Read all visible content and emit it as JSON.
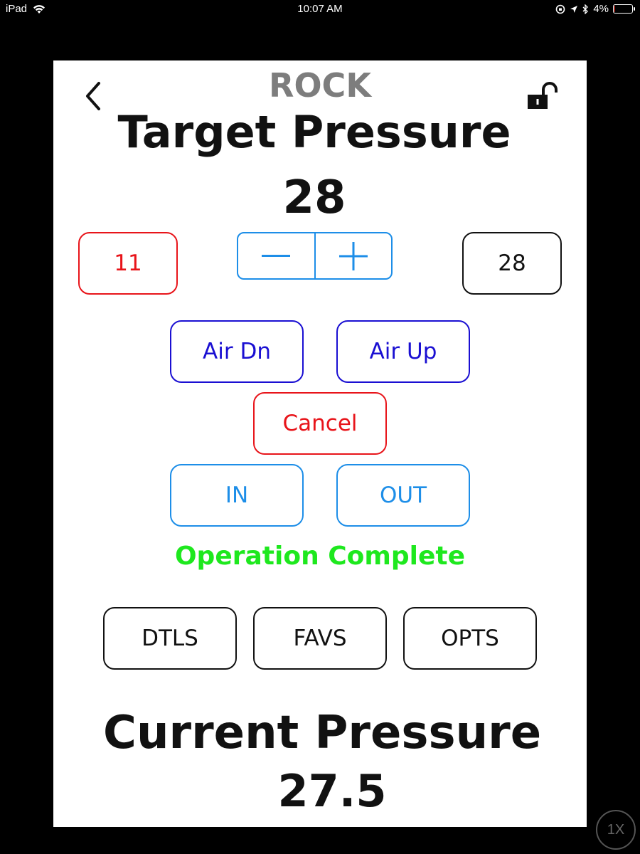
{
  "status_bar": {
    "device": "iPad",
    "time": "10:07 AM",
    "battery": "4%",
    "battery_level": 0.04
  },
  "header": {
    "title": "ROCK",
    "back_icon": "chevron-left-icon",
    "lock_icon": "unlocked-padlock-icon"
  },
  "target": {
    "title": "Target Pressure",
    "value": "28",
    "min_value": "11",
    "max_value": "28",
    "stepper": {
      "decrement": "minus-icon",
      "increment": "plus-icon"
    }
  },
  "controls": {
    "air_down": "Air Dn",
    "air_up": "Air Up",
    "cancel": "Cancel",
    "in": "IN",
    "out": "OUT"
  },
  "status_message": "Operation Complete",
  "nav": {
    "details": "DTLS",
    "favorites": "FAVS",
    "options": "OPTS"
  },
  "current": {
    "title": "Current Pressure",
    "value": "27.5"
  },
  "zoom_badge": "1X",
  "colors": {
    "red": "#e8141a",
    "blue": "#1a0fd2",
    "light_blue": "#1d8ee8",
    "green": "#1ee81e",
    "gray": "#7d7d7d"
  }
}
